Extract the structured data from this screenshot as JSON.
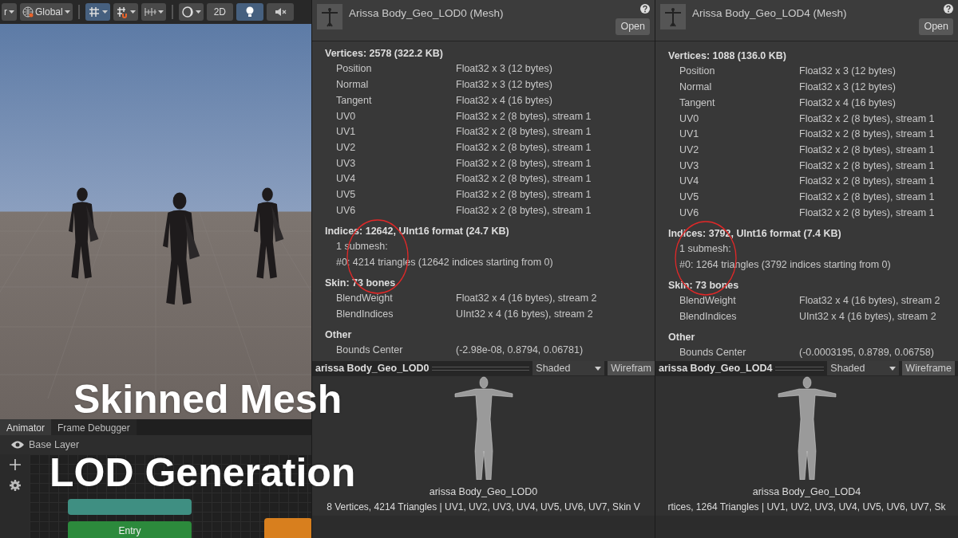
{
  "toolbar": {
    "items": [
      {
        "kind": "dropdown",
        "label": "r",
        "selected": false
      },
      {
        "kind": "globe-dropdown",
        "label": "Global",
        "selected": false
      },
      {
        "kind": "grid-split",
        "selected": true
      },
      {
        "kind": "snap-split",
        "selected": false
      },
      {
        "kind": "ruler-split",
        "selected": false
      },
      {
        "kind": "orbit-split",
        "selected": false
      },
      {
        "kind": "text",
        "label": "2D",
        "selected": false
      },
      {
        "kind": "light",
        "selected": true
      },
      {
        "kind": "audio",
        "selected": false
      }
    ]
  },
  "animator": {
    "tabs": [
      {
        "label": "Animator",
        "selected": true
      },
      {
        "label": "Frame Debugger",
        "selected": false
      }
    ],
    "layer": "Base Layer",
    "nodes": [
      {
        "kind": "any-state"
      },
      {
        "kind": "entry",
        "label": "Entry"
      },
      {
        "kind": "state"
      }
    ]
  },
  "inspectors": [
    {
      "title": "Arissa Body_Geo_LOD0 (Mesh)",
      "open_button": "Open",
      "sections": [
        {
          "heading": "Vertices: 2578 (322.2 KB)",
          "rows": [
            {
              "name": "Position",
              "value": "Float32 x 3 (12 bytes)"
            },
            {
              "name": "Normal",
              "value": "Float32 x 3 (12 bytes)"
            },
            {
              "name": "Tangent",
              "value": "Float32 x 4 (16 bytes)"
            },
            {
              "name": "UV0",
              "value": "Float32 x 2 (8 bytes), stream 1"
            },
            {
              "name": "UV1",
              "value": "Float32 x 2 (8 bytes), stream 1"
            },
            {
              "name": "UV2",
              "value": "Float32 x 2 (8 bytes), stream 1"
            },
            {
              "name": "UV3",
              "value": "Float32 x 2 (8 bytes), stream 1"
            },
            {
              "name": "UV4",
              "value": "Float32 x 2 (8 bytes), stream 1"
            },
            {
              "name": "UV5",
              "value": "Float32 x 2 (8 bytes), stream 1"
            },
            {
              "name": "UV6",
              "value": "Float32 x 2 (8 bytes), stream 1"
            }
          ]
        },
        {
          "heading": "Indices: 12642, UInt16 format (24.7 KB)",
          "lines": [
            "1 submesh:",
            "#0: 4214 triangles (12642 indices starting from 0)"
          ]
        },
        {
          "heading": "Skin: 73 bones",
          "rows": [
            {
              "name": "BlendWeight",
              "value": "Float32 x 4 (16 bytes), stream 2"
            },
            {
              "name": "BlendIndices",
              "value": "UInt32 x 4 (16 bytes), stream 2"
            }
          ]
        },
        {
          "heading": "Other",
          "rows": [
            {
              "name": "Bounds Center",
              "value": "(-2.98e-08, 0.8794, 0.06781)"
            }
          ]
        }
      ],
      "preview": {
        "name": "arissa Body_Geo_LOD0",
        "shading": "Shaded",
        "wireframe": "Wirefram",
        "label": "arissa Body_Geo_LOD0",
        "stats": "8 Vertices, 4214 Triangles | UV1, UV2, UV3, UV4, UV5, UV6, UV7, Skin V"
      }
    },
    {
      "title": "Arissa Body_Geo_LOD4 (Mesh)",
      "open_button": "Open",
      "sections": [
        {
          "heading": "Vertices: 1088 (136.0 KB)",
          "rows": [
            {
              "name": "Position",
              "value": "Float32 x 3 (12 bytes)"
            },
            {
              "name": "Normal",
              "value": "Float32 x 3 (12 bytes)"
            },
            {
              "name": "Tangent",
              "value": "Float32 x 4 (16 bytes)"
            },
            {
              "name": "UV0",
              "value": "Float32 x 2 (8 bytes), stream 1"
            },
            {
              "name": "UV1",
              "value": "Float32 x 2 (8 bytes), stream 1"
            },
            {
              "name": "UV2",
              "value": "Float32 x 2 (8 bytes), stream 1"
            },
            {
              "name": "UV3",
              "value": "Float32 x 2 (8 bytes), stream 1"
            },
            {
              "name": "UV4",
              "value": "Float32 x 2 (8 bytes), stream 1"
            },
            {
              "name": "UV5",
              "value": "Float32 x 2 (8 bytes), stream 1"
            },
            {
              "name": "UV6",
              "value": "Float32 x 2 (8 bytes), stream 1"
            }
          ]
        },
        {
          "heading": "Indices: 3792, UInt16 format (7.4 KB)",
          "lines": [
            "1 submesh:",
            "#0: 1264 triangles (3792 indices starting from 0)"
          ]
        },
        {
          "heading": "Skin: 73 bones",
          "rows": [
            {
              "name": "BlendWeight",
              "value": "Float32 x 4 (16 bytes), stream 2"
            },
            {
              "name": "BlendIndices",
              "value": "UInt32 x 4 (16 bytes), stream 2"
            }
          ]
        },
        {
          "heading": "Other",
          "rows": [
            {
              "name": "Bounds Center",
              "value": "(-0.0003195, 0.8789, 0.06758)"
            }
          ]
        }
      ],
      "preview": {
        "name": "arissa Body_Geo_LOD4",
        "shading": "Shaded",
        "wireframe": "Wireframe",
        "label": "arissa Body_Geo_LOD4",
        "stats": "rtices, 1264 Triangles | UV1, UV2, UV3, UV4, UV5, UV6, UV7, Sk"
      }
    }
  ],
  "overlay_title": [
    "Skinned Mesh",
    "LOD Generation"
  ]
}
